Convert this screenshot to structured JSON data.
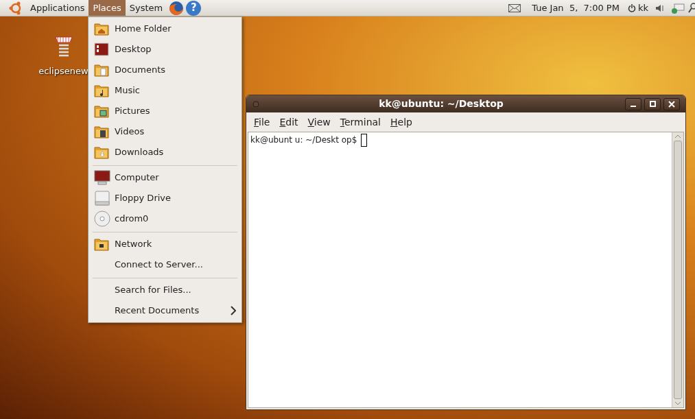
{
  "top_panel": {
    "menus": [
      {
        "label": "Applications",
        "selected": false
      },
      {
        "label": "Places",
        "selected": true
      },
      {
        "label": "System",
        "selected": false
      }
    ],
    "help_glyph": "?",
    "clock": "Tue Jan  5,  7:00 PM",
    "user": "kk"
  },
  "desktop_icons": [
    {
      "label": "eclipsenew"
    }
  ],
  "places_menu": {
    "sections": [
      [
        {
          "label": "Home Folder",
          "kind": "home",
          "submenu": false
        },
        {
          "label": "Desktop",
          "kind": "desktop",
          "submenu": false
        },
        {
          "label": "Documents",
          "kind": "documents",
          "submenu": false
        },
        {
          "label": "Music",
          "kind": "music",
          "submenu": false
        },
        {
          "label": "Pictures",
          "kind": "pictures",
          "submenu": false
        },
        {
          "label": "Videos",
          "kind": "videos",
          "submenu": false
        },
        {
          "label": "Downloads",
          "kind": "downloads",
          "submenu": false
        }
      ],
      [
        {
          "label": "Computer",
          "kind": "computer",
          "submenu": false
        },
        {
          "label": "Floppy Drive",
          "kind": "floppy",
          "submenu": false
        },
        {
          "label": "cdrom0",
          "kind": "cdrom",
          "submenu": false
        }
      ],
      [
        {
          "label": "Network",
          "kind": "network",
          "submenu": false
        },
        {
          "label": "Connect to Server...",
          "kind": "plain",
          "submenu": false
        }
      ],
      [
        {
          "label": "Search for Files...",
          "kind": "plain",
          "submenu": false
        },
        {
          "label": "Recent Documents",
          "kind": "plain",
          "submenu": true
        }
      ]
    ]
  },
  "terminal": {
    "title": "kk@ubuntu: ~/Desktop",
    "menus": [
      "File",
      "Edit",
      "View",
      "Terminal",
      "Help"
    ],
    "prompt": "kk@ubunt u: ~/Deskt op$"
  }
}
